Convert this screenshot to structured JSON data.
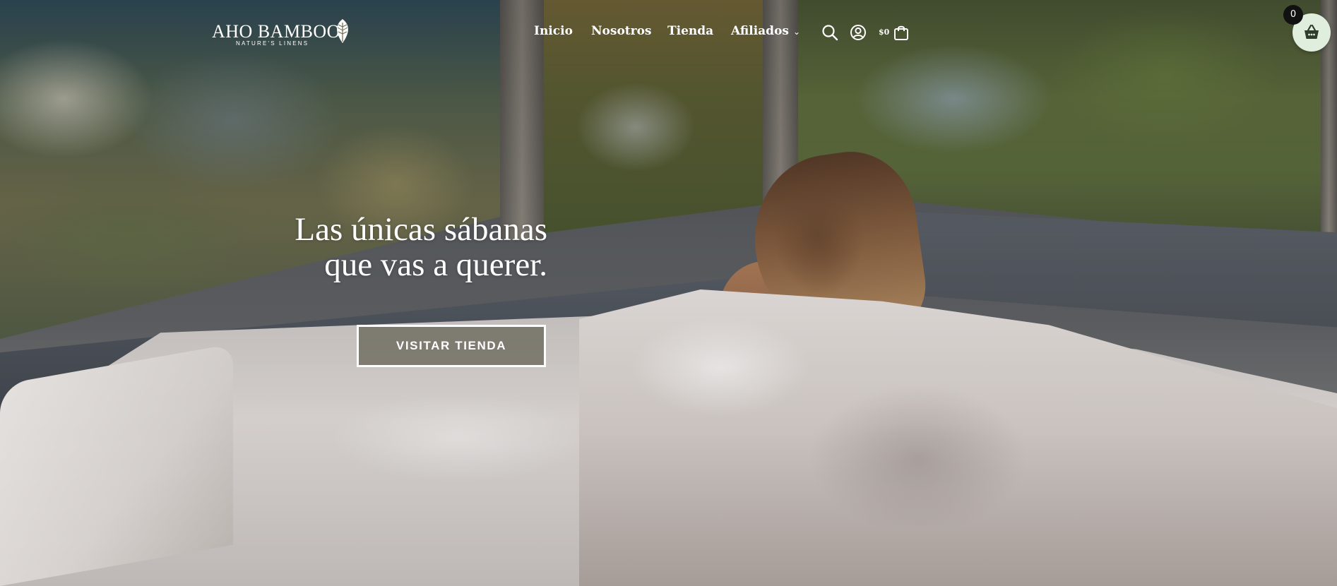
{
  "brand": {
    "name": "AHO BAMBOO",
    "tagline": "NATURE'S LINENS",
    "logo_icon": "leaf-icon"
  },
  "nav": {
    "items": [
      {
        "label": "Inicio"
      },
      {
        "label": "Nosotros"
      },
      {
        "label": "Tienda"
      },
      {
        "label": "Afiliados",
        "has_dropdown": true,
        "caret": "⌄"
      }
    ]
  },
  "header_actions": {
    "search_icon": "search-icon",
    "account_icon": "account-icon",
    "cart_price": "$0",
    "cart_icon": "shopping-bag-icon"
  },
  "floating_cart": {
    "count": "0",
    "icon": "basket-icon",
    "color": "#dfeedd"
  },
  "hero": {
    "title_line_1": "Las únicas sábanas",
    "title_line_2": "que vas a querer.",
    "button_label": "VISITAR TIENDA",
    "background_image": "woman-in-bed-window-view-photo"
  },
  "colors": {
    "text": "#ffffff",
    "button_border": "#ffffff",
    "basket_icon": "#2f3e2c"
  }
}
